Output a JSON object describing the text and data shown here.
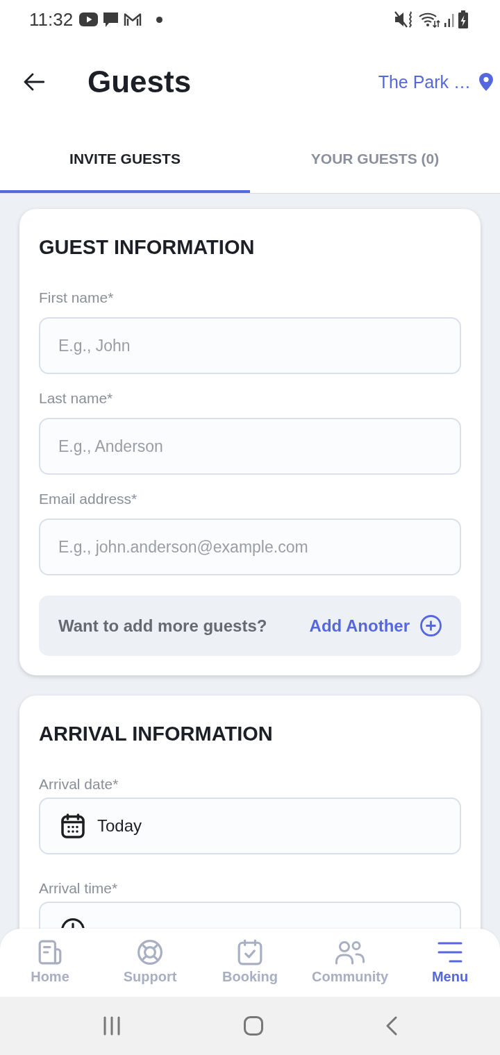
{
  "status_bar": {
    "time": "11:32"
  },
  "header": {
    "title": "Guests",
    "location": "The Park …"
  },
  "tabs": [
    {
      "label": "INVITE GUESTS",
      "selected": true
    },
    {
      "label": "YOUR GUESTS (0)",
      "selected": false
    }
  ],
  "guest_information": {
    "title": "GUEST INFORMATION",
    "fields": [
      {
        "label": "First name*",
        "placeholder": "E.g., John"
      },
      {
        "label": "Last name*",
        "placeholder": "E.g., Anderson"
      },
      {
        "label": "Email address*",
        "placeholder": "E.g., john.anderson@example.com"
      }
    ],
    "add_more": {
      "prompt": "Want to add more guests?",
      "action": "Add Another"
    }
  },
  "arrival_information": {
    "title": "ARRIVAL INFORMATION",
    "fields": [
      {
        "kind": "date",
        "label": "Arrival date*",
        "value": "Today"
      },
      {
        "kind": "time",
        "label": "Arrival time*"
      }
    ]
  },
  "bottom_nav": [
    {
      "label": "Home",
      "selected": false
    },
    {
      "label": "Support",
      "selected": false
    },
    {
      "label": "Booking",
      "selected": false
    },
    {
      "label": "Community",
      "selected": false
    },
    {
      "label": "Menu",
      "selected": true
    }
  ]
}
